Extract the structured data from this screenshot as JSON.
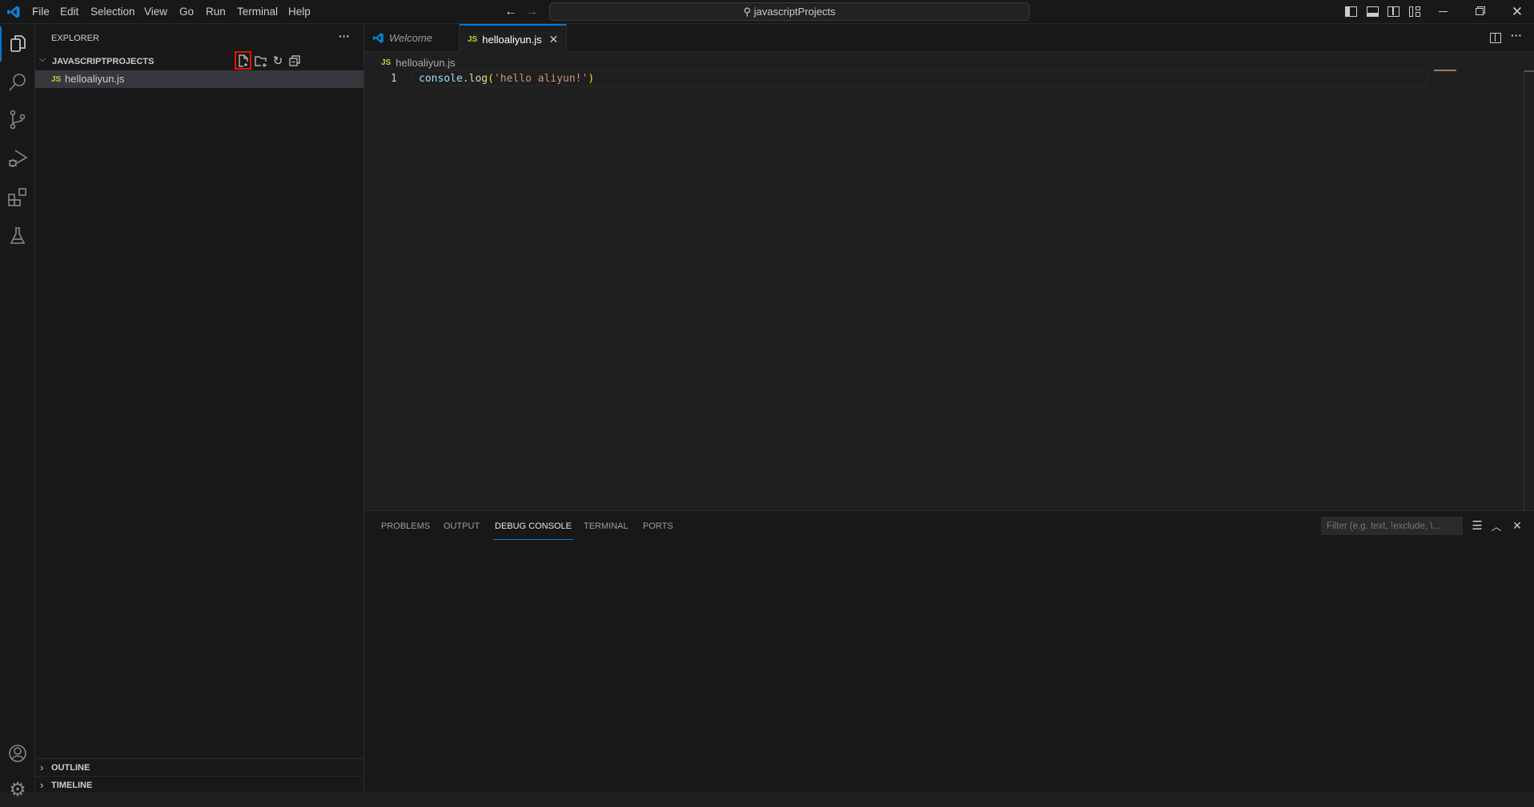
{
  "titlebar": {
    "menu": [
      "File",
      "Edit",
      "Selection",
      "View",
      "Go",
      "Run",
      "Terminal",
      "Help"
    ],
    "search": "javascriptProjects"
  },
  "sidebar": {
    "title": "EXPLORER",
    "more": "···",
    "project": "JAVASCRIPTPROJECTS",
    "files": [
      {
        "icon": "JS",
        "name": "helloaliyun.js"
      }
    ],
    "outline": "OUTLINE",
    "timeline": "TIMELINE"
  },
  "editor": {
    "tabs": [
      {
        "label": "Welcome"
      },
      {
        "icon": "JS",
        "label": "helloaliyun.js"
      }
    ],
    "breadcrumb": {
      "icon": "JS",
      "file": "helloaliyun.js"
    },
    "line_number": "1",
    "code": {
      "obj": "console",
      "dot": ".",
      "fn": "log",
      "open": "(",
      "str": "'hello aliyun!'",
      "close": ")"
    },
    "more": "···"
  },
  "panel": {
    "tabs": [
      "PROBLEMS",
      "OUTPUT",
      "DEBUG CONSOLE",
      "TERMINAL",
      "PORTS"
    ],
    "active": "DEBUG CONSOLE",
    "filter_placeholder": "Filter (e.g. text, !exclude, \\..."
  },
  "colors": {
    "accent": "#0078d4",
    "highlight": "#e51400"
  }
}
